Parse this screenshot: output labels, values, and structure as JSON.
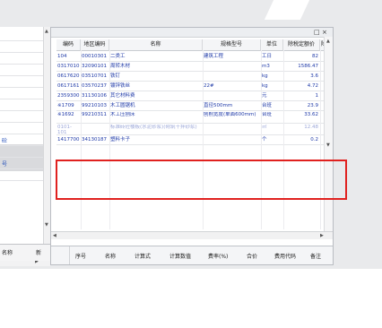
{
  "window": {
    "minimize_icon": "□",
    "close_icon": "×",
    "scroll_up": "▲",
    "scroll_down": "▼",
    "scroll_left": "◀",
    "scroll_right": "▶"
  },
  "left_panel": {
    "items": [
      {
        "label": ""
      },
      {
        "label": ""
      },
      {
        "label": ""
      },
      {
        "label": ""
      },
      {
        "label": ""
      },
      {
        "label": ""
      },
      {
        "label": ""
      },
      {
        "label": ""
      },
      {
        "label": ""
      },
      {
        "label": "砼"
      },
      {
        "label": ""
      },
      {
        "label": "号"
      },
      {
        "label": ""
      }
    ],
    "header_cols": [
      "名称",
      "新"
    ]
  },
  "grid": {
    "headers": [
      "编码",
      "地区编码",
      "名称",
      "规格型号",
      "单位",
      "除税定额价",
      "除"
    ],
    "rows": [
      {
        "code": "104",
        "region": "00010301",
        "name": "二类工",
        "spec": "建筑工程",
        "unit": "工日",
        "price": "82"
      },
      {
        "code": "0317010",
        "region": "32090101",
        "name": "周转木材",
        "spec": "",
        "unit": "m3",
        "price": "1586.47"
      },
      {
        "code": "0617620",
        "region": "03510701",
        "name": "铁钉",
        "spec": "",
        "unit": "kg",
        "price": "3.6"
      },
      {
        "code": "0617161",
        "region": "03570237",
        "name": "镀锌铁丝",
        "spec": "22#",
        "unit": "kg",
        "price": "4.72"
      },
      {
        "code": "2359300",
        "region": "31130106",
        "name": "其它材料费",
        "spec": "",
        "unit": "元",
        "price": "1"
      },
      {
        "code": "※1709",
        "region": "99210103",
        "name": "木工圆锯机",
        "spec": "直径500mm",
        "unit": "台班",
        "price": "23.9"
      },
      {
        "code": "※1692",
        "region": "99210311",
        "name": "木工压刨床",
        "spec": "刨削宽度(单面600mm)",
        "unit": "台班",
        "price": "33.62"
      },
      {
        "code": "0101-101",
        "region": "",
        "name": "标准砖砼楼板(水泥砂浆)(砌筑干拌砂浆)",
        "spec": "",
        "unit": "㎡",
        "price": "12.48"
      },
      {
        "code": "1417700",
        "region": "34130187",
        "name": "塑料卡子",
        "spec": "",
        "unit": "个",
        "price": "0.2"
      }
    ]
  },
  "bottom_headers": [
    "序号",
    "名称",
    "计算式",
    "计算数值",
    "费率(%)",
    "合价",
    "费用代码",
    "备注"
  ]
}
